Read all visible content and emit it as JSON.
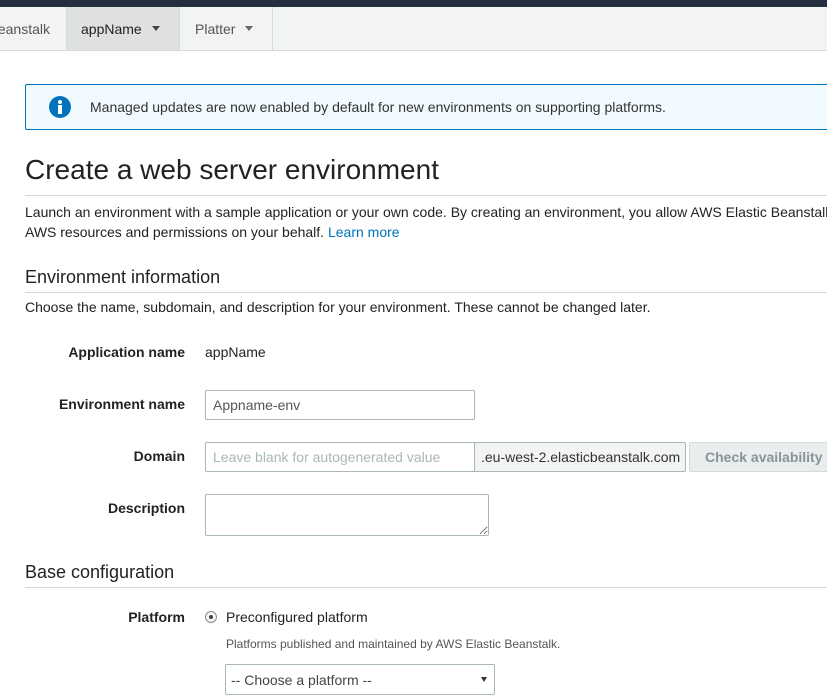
{
  "breadcrumbs": [
    {
      "label": "eanstalk"
    },
    {
      "label": "appName"
    },
    {
      "label": "Platter"
    }
  ],
  "alert": {
    "icon": "info-icon",
    "text": "Managed updates are now enabled by default for new environments on supporting platforms."
  },
  "page": {
    "title": "Create a web server environment",
    "intro_line1": "Launch an environment with a sample application or your own code. By creating an environment, you allow AWS Elastic Beanstalk",
    "intro_line2": "AWS resources and permissions on your behalf.",
    "learn_more": "Learn more"
  },
  "env_info": {
    "heading": "Environment information",
    "description": "Choose the name, subdomain, and description for your environment. These cannot be changed later.",
    "application_name_label": "Application name",
    "application_name_value": "appName",
    "environment_name_label": "Environment name",
    "environment_name_value": "Appname-env",
    "domain_label": "Domain",
    "domain_placeholder": "Leave blank for autogenerated value",
    "domain_suffix": ".eu-west-2.elasticbeanstalk.com",
    "check_availability": "Check availability",
    "description_label": "Description",
    "description_value": ""
  },
  "base_config": {
    "heading": "Base configuration",
    "platform_label": "Platform",
    "platform_option": "Preconfigured platform",
    "platform_help": "Platforms published and maintained by AWS Elastic Beanstalk.",
    "platform_select": "-- Choose a platform --"
  }
}
